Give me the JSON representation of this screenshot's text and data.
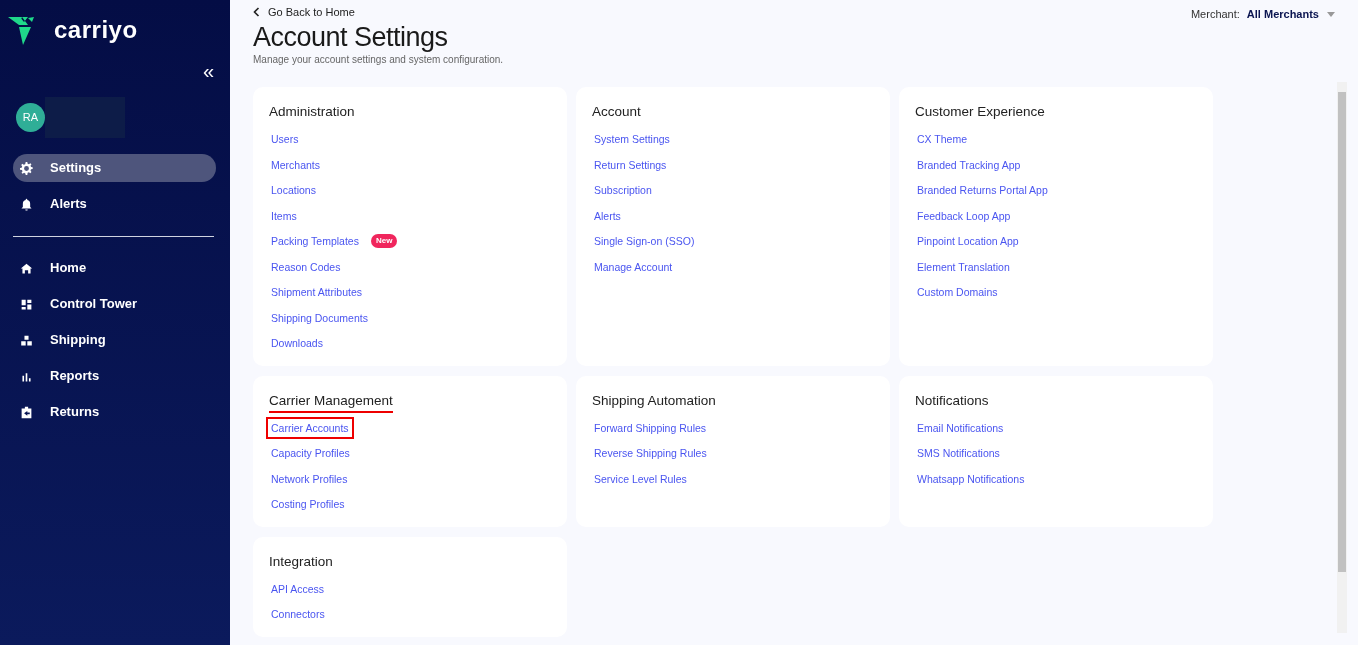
{
  "sidebar": {
    "brand": "carriyo",
    "collapse": "«",
    "user": {
      "initials": "RA"
    },
    "top_items": [
      {
        "label": "Settings",
        "selected": true
      },
      {
        "label": "Alerts",
        "selected": false
      }
    ],
    "items": [
      {
        "label": "Home",
        "selected": false
      },
      {
        "label": "Control Tower",
        "selected": false
      },
      {
        "label": "Shipping",
        "selected": false
      },
      {
        "label": "Reports",
        "selected": false
      },
      {
        "label": "Returns",
        "selected": false
      }
    ]
  },
  "header": {
    "back": "Go Back to Home",
    "title": "Account Settings",
    "subtitle": "Manage your account settings and system configuration.",
    "merchant_label": "Merchant:",
    "merchant_value": "All Merchants"
  },
  "cards": [
    {
      "title": "Administration",
      "underlined": false,
      "links": [
        {
          "label": "Users",
          "highlighted": false
        },
        {
          "label": "Merchants",
          "highlighted": false
        },
        {
          "label": "Locations",
          "highlighted": false
        },
        {
          "label": "Items",
          "highlighted": false
        },
        {
          "label": "Packing Templates",
          "badge": "New",
          "highlighted": false
        },
        {
          "label": "Reason Codes",
          "highlighted": false
        },
        {
          "label": "Shipment Attributes",
          "highlighted": false
        },
        {
          "label": "Shipping Documents",
          "highlighted": false
        },
        {
          "label": "Downloads",
          "highlighted": false
        }
      ]
    },
    {
      "title": "Account",
      "underlined": false,
      "links": [
        {
          "label": "System Settings",
          "highlighted": false
        },
        {
          "label": "Return Settings",
          "highlighted": false
        },
        {
          "label": "Subscription",
          "highlighted": false
        },
        {
          "label": "Alerts",
          "highlighted": false
        },
        {
          "label": "Single Sign-on (SSO)",
          "highlighted": false
        },
        {
          "label": "Manage Account",
          "highlighted": false
        }
      ]
    },
    {
      "title": "Customer Experience",
      "underlined": false,
      "links": [
        {
          "label": "CX Theme",
          "highlighted": false
        },
        {
          "label": "Branded Tracking App",
          "highlighted": false
        },
        {
          "label": "Branded Returns Portal App",
          "highlighted": false
        },
        {
          "label": "Feedback Loop App",
          "highlighted": false
        },
        {
          "label": "Pinpoint Location App",
          "highlighted": false
        },
        {
          "label": "Element Translation",
          "highlighted": false
        },
        {
          "label": "Custom Domains",
          "highlighted": false
        }
      ]
    },
    {
      "title": "Carrier Management",
      "underlined": true,
      "links": [
        {
          "label": "Carrier Accounts",
          "highlighted": true
        },
        {
          "label": "Capacity Profiles",
          "highlighted": false
        },
        {
          "label": "Network Profiles",
          "highlighted": false
        },
        {
          "label": "Costing Profiles",
          "highlighted": false
        }
      ]
    },
    {
      "title": "Shipping Automation",
      "underlined": false,
      "links": [
        {
          "label": "Forward Shipping Rules",
          "highlighted": false
        },
        {
          "label": "Reverse Shipping Rules",
          "highlighted": false
        },
        {
          "label": "Service Level Rules",
          "highlighted": false
        }
      ]
    },
    {
      "title": "Notifications",
      "underlined": false,
      "links": [
        {
          "label": "Email Notifications",
          "highlighted": false
        },
        {
          "label": "SMS Notifications",
          "highlighted": false
        },
        {
          "label": "Whatsapp Notifications",
          "highlighted": false
        }
      ]
    },
    {
      "title": "Integration",
      "underlined": false,
      "links": [
        {
          "label": "API Access",
          "highlighted": false
        },
        {
          "label": "Connectors",
          "highlighted": false
        }
      ]
    }
  ]
}
